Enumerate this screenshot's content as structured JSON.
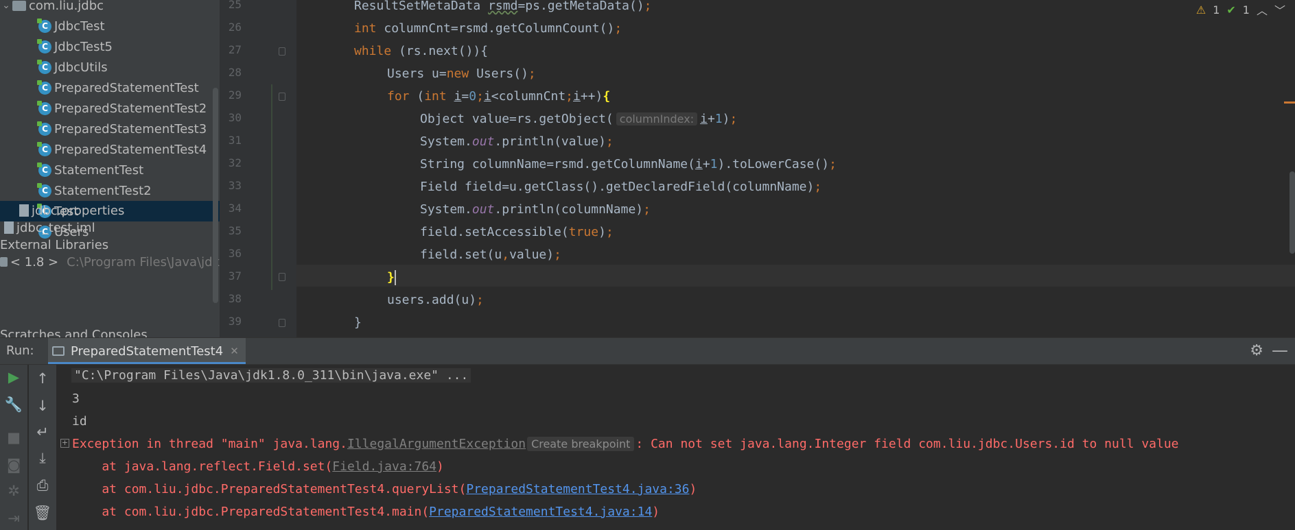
{
  "project_tree": {
    "package": "com.liu.jdbc",
    "classes": [
      {
        "label": "JdbcTest",
        "selected": false
      },
      {
        "label": "JdbcTest5",
        "selected": false
      },
      {
        "label": "JdbcUtils",
        "selected": false
      },
      {
        "label": "PreparedStatementTest",
        "selected": false
      },
      {
        "label": "PreparedStatementTest2",
        "selected": false
      },
      {
        "label": "PreparedStatementTest3",
        "selected": false
      },
      {
        "label": "PreparedStatementTest4",
        "selected": false
      },
      {
        "label": "StatementTest",
        "selected": false
      },
      {
        "label": "StatementTest2",
        "selected": false
      },
      {
        "label": "Test",
        "selected": true
      },
      {
        "label": "Users",
        "selected": false
      }
    ],
    "properties_file": "jdbc.properties",
    "iml_file": "jdbc_test.iml",
    "external_libraries": "External Libraries",
    "jdk_label": "< 1.8 >",
    "jdk_path": "C:\\Program Files\\Java\\jdk",
    "scratches": "Scratches and Consoles"
  },
  "editor": {
    "line_numbers": [
      "25",
      "26",
      "27",
      "28",
      "29",
      "30",
      "31",
      "32",
      "33",
      "34",
      "35",
      "36",
      "37",
      "38",
      "39"
    ],
    "param_hint": "columnIndex:",
    "inspections": {
      "warnings": "1",
      "ok": "1",
      "warning_icon": "warning-triangle-icon",
      "ok_icon": "double-check-icon"
    }
  },
  "run_panel": {
    "label": "Run:",
    "tab": "PreparedStatementTest4",
    "console": {
      "command": "\"C:\\Program Files\\Java\\jdk1.8.0_311\\bin\\java.exe\" ...",
      "out1": "3",
      "out2": "id",
      "exception_prefix": "Exception in thread \"main\" java.lang.",
      "exception_class": "IllegalArgumentException",
      "create_breakpoint": "Create breakpoint",
      "exception_message": ": Can not set java.lang.Integer field com.liu.jdbc.Users.id to null value",
      "frames": [
        {
          "prefix": "    at java.lang.reflect.Field.set(",
          "link": "Field.java:764",
          "suffix": ")",
          "library": true
        },
        {
          "prefix": "    at com.liu.jdbc.PreparedStatementTest4.queryList(",
          "link": "PreparedStatementTest4.java:36",
          "suffix": ")",
          "library": false
        },
        {
          "prefix": "    at com.liu.jdbc.PreparedStatementTest4.main(",
          "link": "PreparedStatementTest4.java:14",
          "suffix": ")",
          "library": false
        }
      ]
    }
  },
  "colors": {
    "keyword": "#cc7832",
    "number": "#6897bb",
    "error": "#ff6b68",
    "link": "#5394ec",
    "selection": "#0d293e"
  }
}
